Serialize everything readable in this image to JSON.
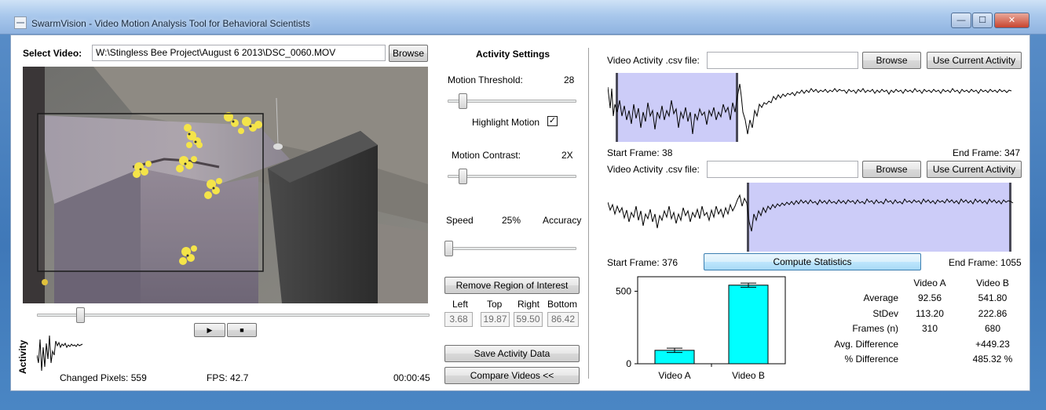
{
  "window": {
    "title": "SwarmVision - Video Motion Analysis Tool for Behavioral Scientists",
    "buttons": {
      "minimize": "—",
      "maximize": "☐",
      "close": "✕"
    }
  },
  "video": {
    "select_label": "Select Video:",
    "path": "W:\\Stingless Bee Project\\August 6 2013\\DSC_0060.MOV",
    "browse_label": "Browse",
    "play_symbol": "▶",
    "stop_symbol": "■",
    "activity_label": "Activity",
    "changed_pixels": "Changed Pixels: 559",
    "fps": "FPS: 42.7",
    "time": "00:00:45",
    "seek_position": 0.11
  },
  "activity_settings": {
    "heading": "Activity Settings",
    "motion_threshold_label": "Motion Threshold:",
    "motion_threshold_value": "28",
    "highlight_motion_label": "Highlight Motion",
    "highlight_motion_checked": "✓",
    "motion_contrast_label": "Motion Contrast:",
    "motion_contrast_value": "2X",
    "speed_label": "Speed",
    "speed_value": "25%",
    "accuracy_label": "Accuracy",
    "remove_roi_label": "Remove Region of Interest",
    "roi_headers": [
      "Left",
      "Top",
      "Right",
      "Bottom"
    ],
    "roi_values": [
      "3.68",
      "19.87",
      "59.50",
      "86.42"
    ],
    "save_label": "Save Activity Data",
    "compare_label": "Compare Videos <<"
  },
  "compare": {
    "csv_label_a": "Video Activity .csv file:",
    "csv_label_b": "Video Activity .csv file:",
    "csv_value_a": "",
    "csv_value_b": "",
    "browse_label": "Browse",
    "use_current_label": "Use Current Activity",
    "start_a": "Start Frame: 38",
    "end_a": "End Frame: 347",
    "start_b": "Start Frame: 376",
    "end_b": "End Frame: 1055",
    "compute_label": "Compute Statistics"
  },
  "chart_data": {
    "type": "bar",
    "categories": [
      "Video A",
      "Video B"
    ],
    "values": [
      92.56,
      541.8
    ],
    "error": [
      15,
      14
    ],
    "yticks": [
      "0",
      "500"
    ],
    "ylim": [
      0,
      600
    ],
    "bar_color": "#00ffff"
  },
  "stats": {
    "headers": [
      "",
      "Video A",
      "Video B"
    ],
    "rows": [
      [
        "Average",
        "92.56",
        "541.80"
      ],
      [
        "StDev",
        "113.20",
        "222.86"
      ],
      [
        "Frames (n)",
        "310",
        "680"
      ],
      [
        "Avg. Difference",
        "",
        "+449.23"
      ],
      [
        "% Difference",
        "",
        "485.32 %"
      ]
    ]
  }
}
